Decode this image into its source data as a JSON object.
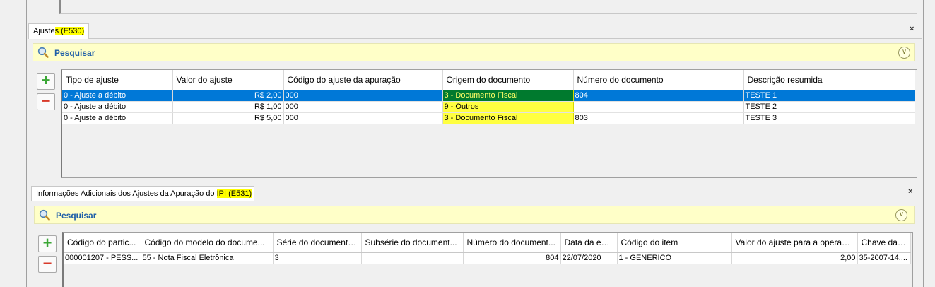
{
  "section1": {
    "tab_label_prefix": "Ajuste",
    "tab_label_highlight": "s (E530)",
    "close_label": "×",
    "search_label": "Pesquisar",
    "columns": [
      "Tipo de ajuste",
      "Valor do ajuste",
      "Código do ajuste da apuração",
      "Origem do documento",
      "Número do documento",
      "Descrição resumida"
    ],
    "rows": [
      {
        "tipo": "0 - Ajuste a débito",
        "valor": "R$ 2,00",
        "codigo": "000",
        "origem": "3 - Documento Fiscal",
        "numero": "804",
        "descricao": "TESTE 1",
        "selected": true
      },
      {
        "tipo": "0 - Ajuste a débito",
        "valor": "R$ 1,00",
        "codigo": "000",
        "origem": "9 - Outros",
        "numero": "",
        "descricao": "TESTE 2",
        "selected": false
      },
      {
        "tipo": "0 - Ajuste a débito",
        "valor": "R$ 5,00",
        "codigo": "000",
        "origem": "3 - Documento Fiscal",
        "numero": "803",
        "descricao": "TESTE 3",
        "selected": false
      }
    ]
  },
  "section2": {
    "tab_label_prefix": "Informações Adicionais dos Ajustes da Apuração do",
    "tab_label_highlight": "IPI (E531)",
    "close_label": "×",
    "search_label": "Pesquisar",
    "columns": [
      "Código do partic...",
      "Código do modelo do docume...",
      "Série do documento...",
      "Subsérie do document...",
      "Número do document...",
      "Data da em...",
      "Código do item",
      "Valor do ajuste para a operaçã...",
      "Chave da ..."
    ],
    "rows": [
      {
        "participante": "000001207 - PESS...",
        "modelo": "55 - Nota Fiscal Eletrônica",
        "serie": "3",
        "subserie": "",
        "numero": "804",
        "data": "22/07/2020",
        "item": "1 - GENERICO",
        "valor": "2,00",
        "chave": "35-2007-14...."
      }
    ]
  },
  "colors": {
    "highlight": "#ffff00",
    "selection": "#0078d7",
    "search_bar": "#ffffc8",
    "search_text": "#1f5fa8"
  },
  "icons": [
    "search-icon",
    "chevron-down-icon",
    "add-icon",
    "remove-icon",
    "close-icon"
  ]
}
